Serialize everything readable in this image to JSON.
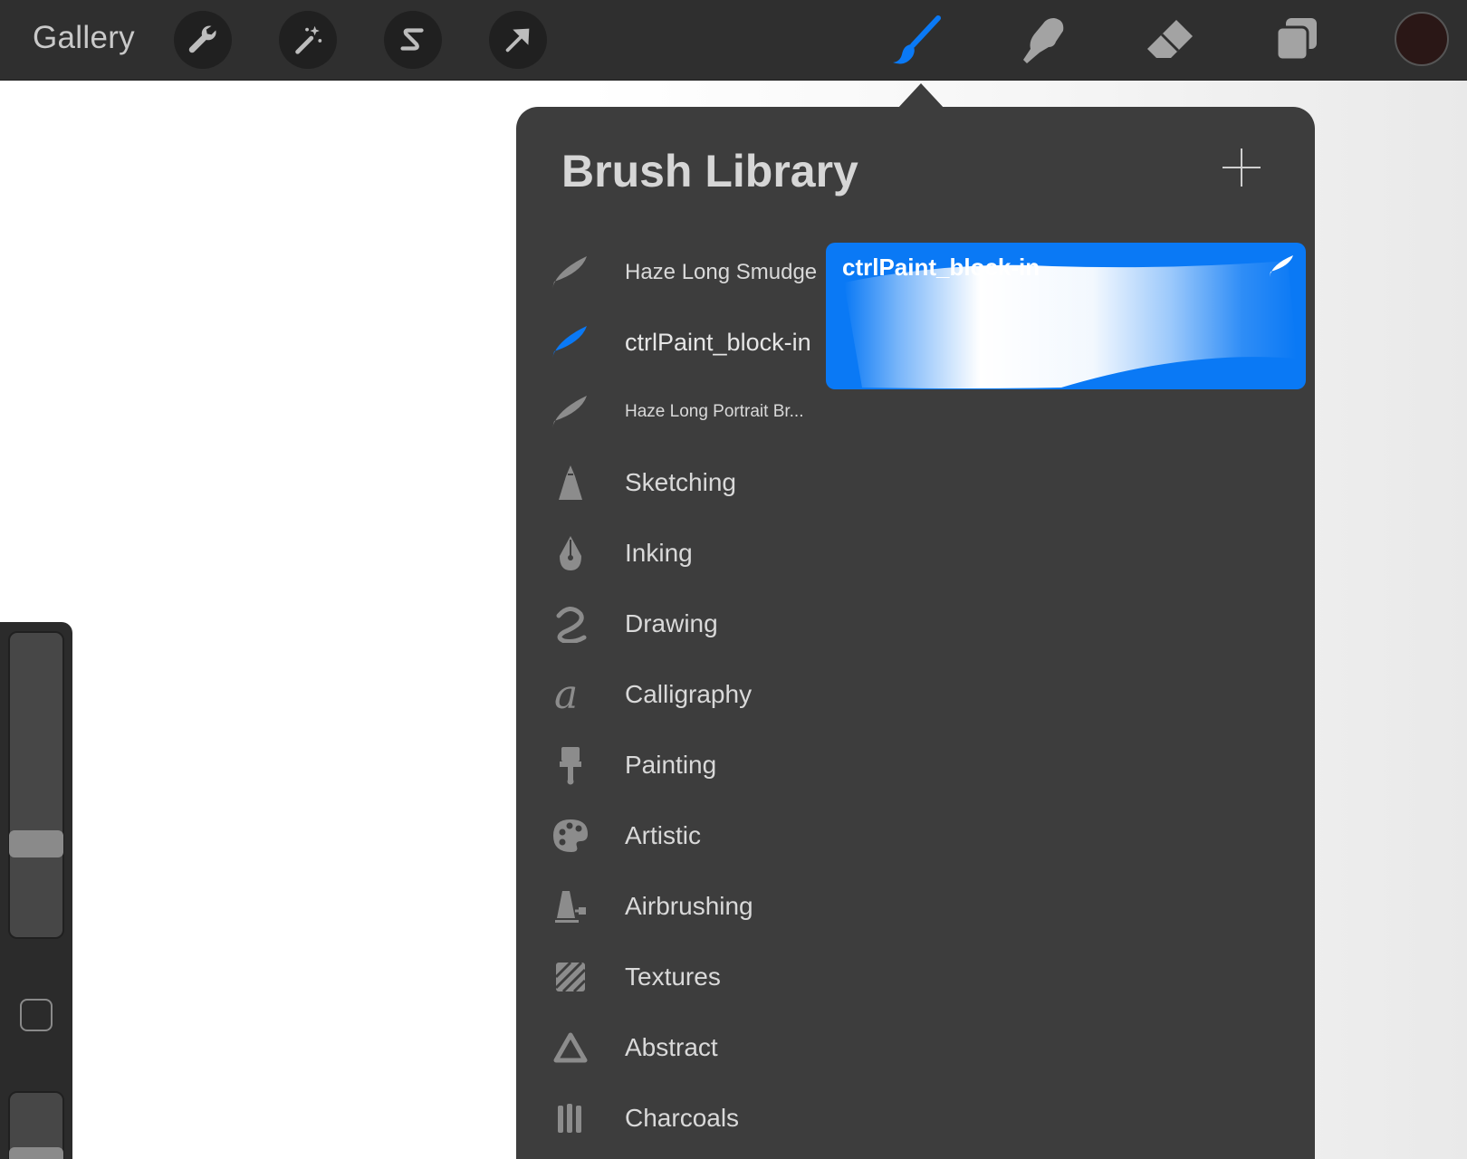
{
  "toolbar": {
    "gallery_label": "Gallery",
    "left_tools": [
      {
        "name": "actions",
        "icon": "wrench-icon"
      },
      {
        "name": "adjustments",
        "icon": "magic-wand-icon"
      },
      {
        "name": "selection",
        "icon": "selection-s-icon"
      },
      {
        "name": "transform",
        "icon": "arrow-cursor-icon"
      }
    ],
    "right_tools": [
      {
        "name": "brush",
        "icon": "brush-icon",
        "active": true
      },
      {
        "name": "smudge",
        "icon": "smudge-finger-icon"
      },
      {
        "name": "eraser",
        "icon": "eraser-icon"
      },
      {
        "name": "layers",
        "icon": "layers-icon"
      }
    ],
    "current_color": "#2a1716",
    "accent_color": "#0a79f5"
  },
  "sidebar": {
    "brush_size_slider_icon": "size-slider",
    "modify_button_icon": "square-icon",
    "opacity_slider_icon": "opacity-slider"
  },
  "brush_library": {
    "title": "Brush Library",
    "add_icon": "plus-icon",
    "selected_preview": {
      "name": "ctrlPaint_block-in",
      "icon": "feather-icon"
    },
    "items": [
      {
        "label": "Haze Long Smudge",
        "icon": "feather-icon",
        "type": "recent",
        "selected": false
      },
      {
        "label": "ctrlPaint_block-in",
        "icon": "feather-icon",
        "type": "recent",
        "selected": true
      },
      {
        "label": "Haze Long Portrait Br...",
        "icon": "feather-icon",
        "type": "recent",
        "selected": false
      },
      {
        "label": "Sketching",
        "icon": "pencil-tip-icon",
        "type": "set"
      },
      {
        "label": "Inking",
        "icon": "pen-nib-icon",
        "type": "set"
      },
      {
        "label": "Drawing",
        "icon": "squiggle-icon",
        "type": "set"
      },
      {
        "label": "Calligraphy",
        "icon": "letter-a-icon",
        "type": "set"
      },
      {
        "label": "Painting",
        "icon": "paintbrush-icon",
        "type": "set"
      },
      {
        "label": "Artistic",
        "icon": "palette-icon",
        "type": "set"
      },
      {
        "label": "Airbrushing",
        "icon": "airbrush-icon",
        "type": "set"
      },
      {
        "label": "Textures",
        "icon": "texture-icon",
        "type": "set"
      },
      {
        "label": "Abstract",
        "icon": "triangle-icon",
        "type": "set"
      },
      {
        "label": "Charcoals",
        "icon": "charcoal-sticks-icon",
        "type": "set"
      }
    ]
  }
}
